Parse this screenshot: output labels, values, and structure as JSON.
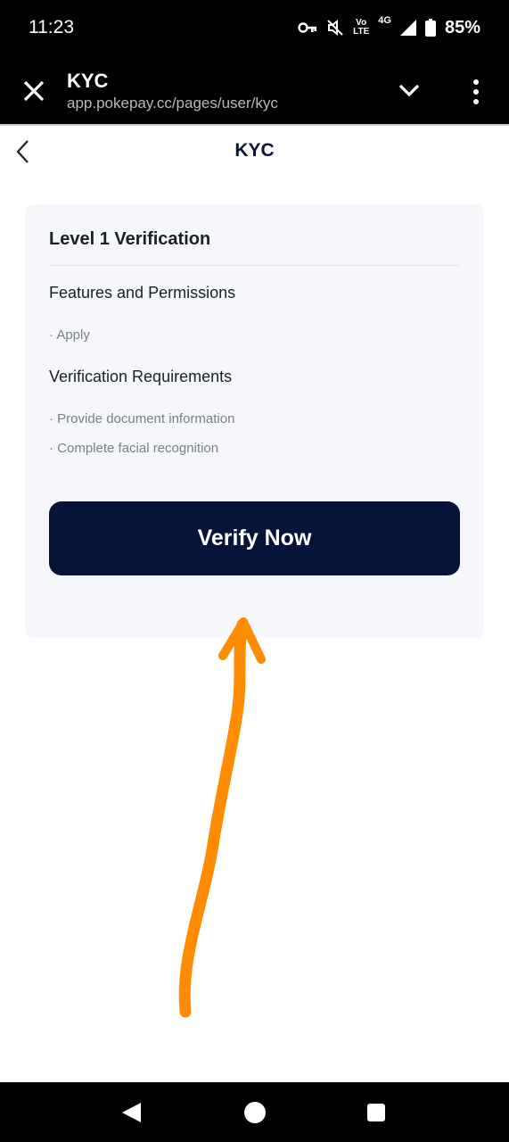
{
  "status_bar": {
    "time": "11:23",
    "volte_top": "Vo",
    "volte_bottom": "LTE",
    "network": "4G",
    "battery": "85%"
  },
  "browser": {
    "title": "KYC",
    "url": "app.pokepay.cc/pages/user/kyc"
  },
  "page": {
    "title": "KYC"
  },
  "card": {
    "title": "Level 1 Verification",
    "features_title": "Features and Permissions",
    "features": [
      "· Apply"
    ],
    "requirements_title": "Verification Requirements",
    "requirements": [
      "· Provide document information",
      "· Complete facial recognition"
    ],
    "button_label": "Verify Now"
  },
  "colors": {
    "button_bg": "#06143a",
    "card_bg": "#f5f7fb",
    "arrow": "#ff8c00"
  }
}
